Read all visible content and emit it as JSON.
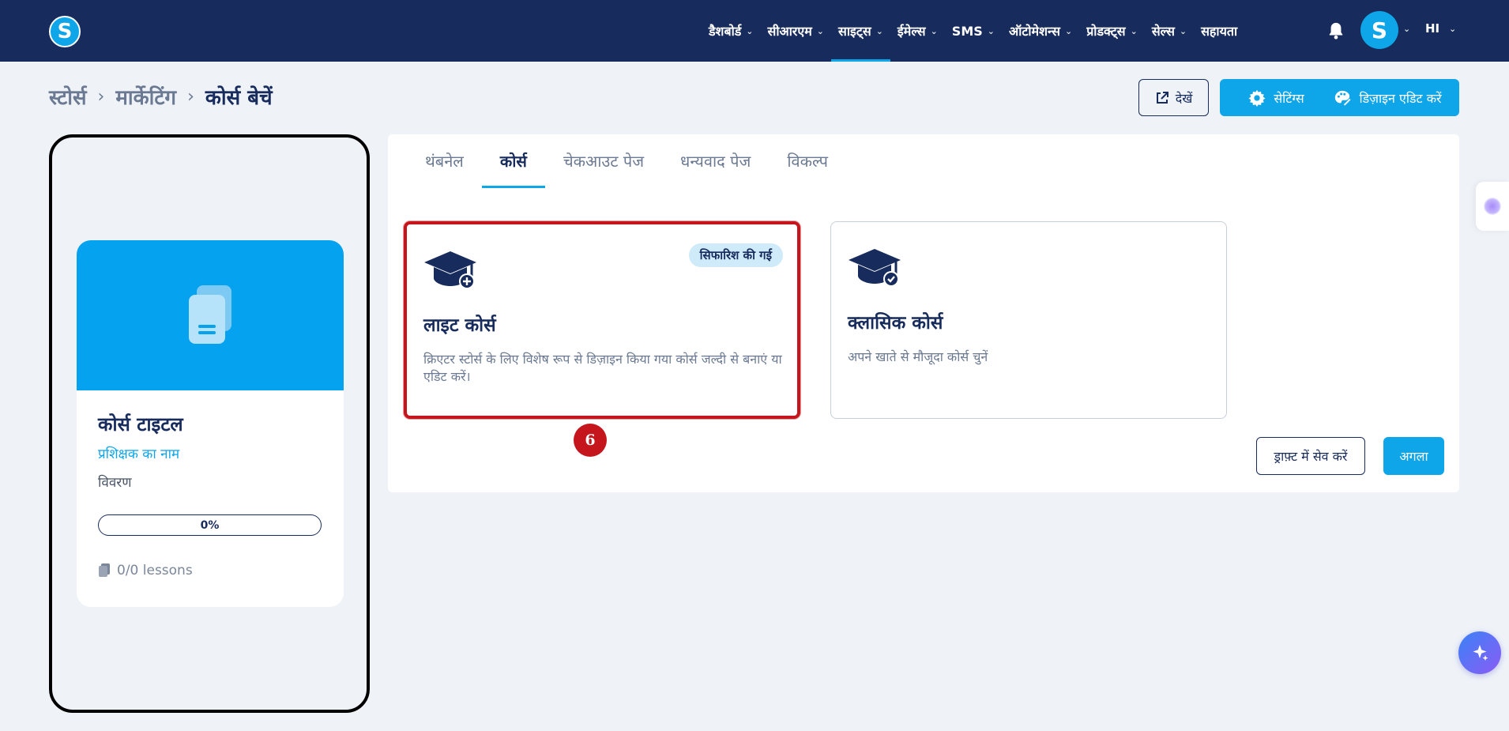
{
  "brand": {
    "logo_letter": "S",
    "accent": "#0ea5e9",
    "navbar_bg": "#172b5c"
  },
  "nav": {
    "items": [
      {
        "label": "डैशबोर्ड"
      },
      {
        "label": "सीआरएम"
      },
      {
        "label": "साइट्स",
        "active": true
      },
      {
        "label": "ईमेल्स"
      },
      {
        "label": "SMS"
      },
      {
        "label": "ऑटोमेशन्स"
      },
      {
        "label": "प्रोडक्ट्स"
      },
      {
        "label": "सेल्स"
      }
    ],
    "help_label": "सहायता",
    "avatar_letter": "S",
    "language": "HI",
    "icons": [
      "bell-icon",
      "chevron-down-icon"
    ]
  },
  "breadcrumb": {
    "items": [
      "स्टोर्स",
      "मार्केटिंग"
    ],
    "current": "कोर्स बेचें"
  },
  "actions": {
    "view_label": "देखें",
    "settings_label": "सेटिंग्स",
    "design_label": "डिज़ाइन एडिट करें"
  },
  "preview": {
    "course_title": "कोर्स टाइटल",
    "instructor": "प्रशिक्षक का नाम",
    "description": "विवरण",
    "progress_label": "0%",
    "progress_value": 0,
    "lessons": "0/0 lessons"
  },
  "tabs": [
    {
      "label": "थंबनेल"
    },
    {
      "label": "कोर्स",
      "active": true
    },
    {
      "label": "चेकआउट पेज"
    },
    {
      "label": "धन्यवाद पेज"
    },
    {
      "label": "विकल्प"
    }
  ],
  "options": [
    {
      "title": "लाइट कोर्स",
      "badge": "सिफारिश की गई",
      "description": "क्रिएटर स्टोर्स के लिए विशेष रूप से डिज़ाइन किया गया कोर्स जल्दी से बनाएं या एडिट करें।",
      "selected": true,
      "icon": "graduation-cap-plus-icon"
    },
    {
      "title": "क्लासिक कोर्स",
      "description": "अपने खाते से मौजूदा कोर्स चुनें",
      "selected": false,
      "icon": "graduation-cap-check-icon"
    }
  ],
  "step_marker": "6",
  "footer": {
    "draft_label": "ड्राफ़्ट में सेव करें",
    "next_label": "अगला"
  },
  "colors": {
    "selected_border": "#c4161c",
    "badge_bg": "#cfeaf9",
    "hero_bg": "#05a2f0"
  }
}
